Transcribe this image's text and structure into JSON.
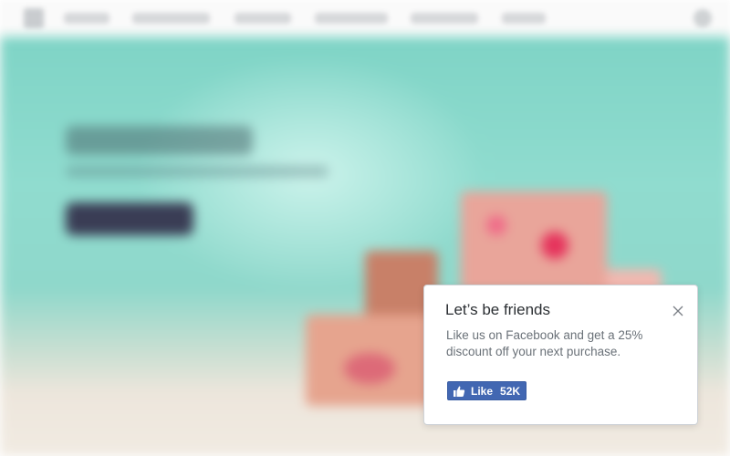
{
  "popup": {
    "title": "Let’s be friends",
    "message": "Like us on Facebook and get a 25% discount off your next purchase.",
    "like_button": {
      "label": "Like",
      "count": "52K"
    }
  },
  "colors": {
    "facebook_blue": "#4267b2",
    "hero_teal": "#8fd8cb"
  },
  "icons": {
    "close": "close-icon",
    "like": "thumbs-up-icon"
  }
}
